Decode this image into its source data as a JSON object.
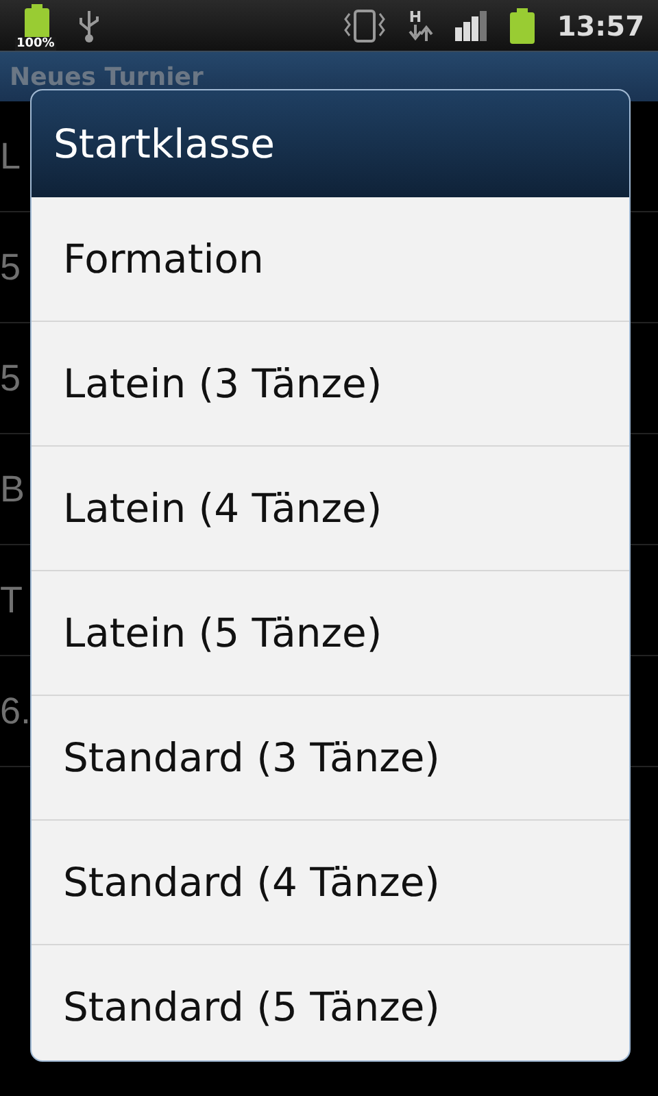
{
  "status_bar": {
    "battery_percent": "100%",
    "network_type": "H",
    "time": "13:57"
  },
  "action_bar": {
    "title": "Neues Turnier"
  },
  "background_rows": [
    {
      "text": "L"
    },
    {
      "text": "5"
    },
    {
      "text": "5"
    },
    {
      "text": "B"
    },
    {
      "text": "T"
    },
    {
      "text": "6."
    }
  ],
  "dialog": {
    "title": "Startklasse",
    "items": [
      {
        "label": "Formation"
      },
      {
        "label": "Latein (3 Tänze)"
      },
      {
        "label": "Latein (4 Tänze)"
      },
      {
        "label": "Latein (5 Tänze)"
      },
      {
        "label": "Standard (3 Tänze)"
      },
      {
        "label": "Standard (4 Tänze)"
      },
      {
        "label": "Standard (5 Tänze)"
      }
    ]
  }
}
